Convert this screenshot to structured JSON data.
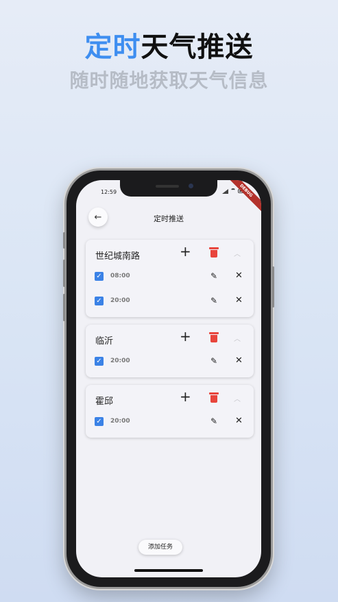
{
  "promo": {
    "title_accent": "定时",
    "title_rest": "天气推送",
    "subtitle": "随时随地获取天气信息"
  },
  "status_bar": {
    "time": "12:59",
    "ribbon": "DEBUG"
  },
  "header": {
    "title": "定时推送",
    "back_icon": "←"
  },
  "cards": [
    {
      "city": "世纪城南路",
      "add_icon": "+",
      "collapse_icon": "︿",
      "tasks": [
        {
          "time": "08:00",
          "checked": true
        },
        {
          "time": "20:00",
          "checked": true
        }
      ]
    },
    {
      "city": "临沂",
      "add_icon": "+",
      "collapse_icon": "︿",
      "tasks": [
        {
          "time": "20:00",
          "checked": true
        }
      ]
    },
    {
      "city": "霍邱",
      "add_icon": "+",
      "collapse_icon": "︿",
      "tasks": [
        {
          "time": "20:00",
          "checked": true
        }
      ]
    }
  ],
  "icons": {
    "check": "✓",
    "edit": "✎",
    "close": "✕"
  },
  "footer": {
    "add_task_label": "添加任务"
  },
  "colors": {
    "accent": "#3e8ef0",
    "checkbox": "#3b82e6",
    "delete": "#e8453c"
  }
}
